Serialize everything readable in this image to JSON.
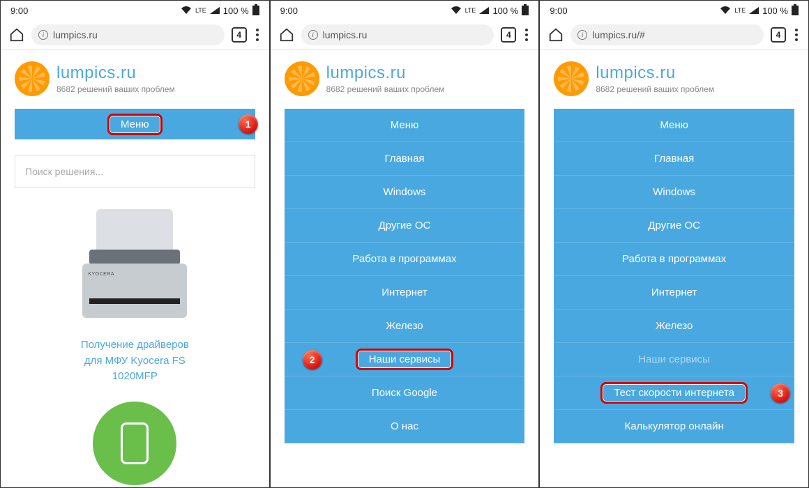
{
  "status": {
    "time": "9:00",
    "lte": "LTE",
    "battery": "100 %"
  },
  "url": {
    "p1": "lumpics.ru",
    "p2": "lumpics.ru",
    "p3": "lumpics.ru/#",
    "tabs": "4"
  },
  "logo": {
    "brand": "lumpics.ru",
    "tag": "8682 решений ваших проблем"
  },
  "panel1": {
    "menu": "Меню",
    "search_placeholder": "Поиск решения...",
    "preview_l1": "Получение драйверов",
    "preview_l2": "для МФУ Kyocera FS",
    "preview_l3": "1020MFP",
    "printer_brand": "KYOCERA"
  },
  "menu_common": {
    "m0": "Меню",
    "m1": "Главная",
    "m2": "Windows",
    "m3": "Другие ОС",
    "m4": "Работа в программах",
    "m5": "Интернет",
    "m6": "Железо",
    "m7": "Наши сервисы",
    "m8": "Поиск Google",
    "m9": "О нас"
  },
  "menu3": {
    "s1": "Тест скорости интернета",
    "s2": "Калькулятор онлайн"
  },
  "markers": {
    "a": "1",
    "b": "2",
    "c": "3"
  }
}
